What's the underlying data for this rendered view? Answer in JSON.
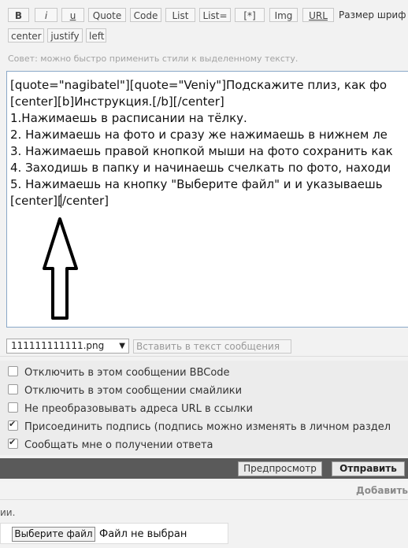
{
  "toolbar": {
    "buttons": [
      "B",
      "i",
      "u",
      "Quote",
      "Code",
      "List",
      "List=",
      "[*]",
      "Img",
      "URL"
    ],
    "font_size_label": "Размер шриф",
    "row2": [
      "center",
      "justify",
      "left"
    ]
  },
  "hint": "Совет: можно быстро применить стили к выделенному тексту.",
  "editor": {
    "lines": [
      "[quote=\"nagibatel\"][quote=\"Veniy\"]Подскажите плиз, как фо",
      "[center][b]Инструкция.[/b][/center]",
      "1.Нажимаешь в расписании на тёлку.",
      "2. Нажимаешь на фото и сразу же нажимаешь в нижнем ле",
      "3. Нажимаешь правой кнопкой мыши на фото сохранить как",
      "4. Заходишь в папку и начинаешь счелкать по фото, находи",
      "5. Нажимаешь на кнопку \"Выберите файл\" и и указываешь",
      "[center][/center]"
    ]
  },
  "attachment": {
    "selected_file": "111111111111.png",
    "insert_button": "Вставить в текст сообщения"
  },
  "options": [
    {
      "label": "Отключить в этом сообщении BBCode",
      "checked": false
    },
    {
      "label": "Отключить в этом сообщении смайлики",
      "checked": false
    },
    {
      "label": "Не преобразовывать адреса URL в ссылки",
      "checked": false
    },
    {
      "label": "Присоединить подпись (подпись можно изменять в личном раздел",
      "checked": true
    },
    {
      "label": "Сообщать мне о получении ответа",
      "checked": true
    }
  ],
  "actions": {
    "preview": "Предпросмотр",
    "submit": "Отправить"
  },
  "add_label": "Добавить",
  "fragment": "ии.",
  "upload": {
    "choose_button": "Выберите файл",
    "no_file": "Файл не выбран"
  }
}
